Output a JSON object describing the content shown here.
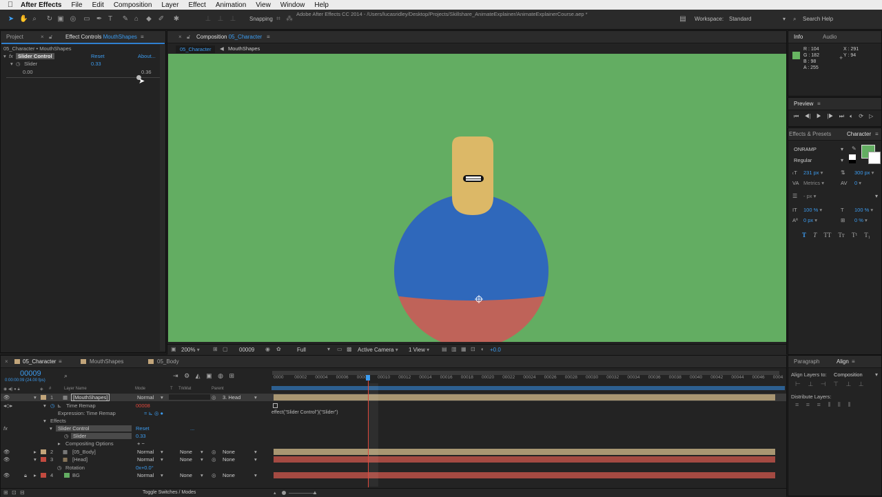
{
  "menubar": {
    "app_name": "After Effects",
    "items": [
      "File",
      "Edit",
      "Composition",
      "Layer",
      "Effect",
      "Animation",
      "View",
      "Window",
      "Help"
    ],
    "window_title": "Adobe After Effects CC 2014 - /Users/lucasridley/Desktop/Projects/Skillshare_AnimateExplainer/AnimateExplainerCourse.aep *"
  },
  "toolbar": {
    "snapping_label": "Snapping",
    "workspace_label": "Workspace:",
    "workspace_value": "Standard",
    "search_help": "Search Help"
  },
  "left_panel": {
    "tab_project": "Project",
    "tab_effect_controls": "Effect Controls",
    "tab_effect_controls_target": "MouthShapes",
    "breadcrumb": "05_Character • MouthShapes",
    "effect_name": "Slider Control",
    "reset_label": "Reset",
    "about_label": "About...",
    "slider_label": "Slider",
    "slider_value": "0.33",
    "slider_min": "0.00",
    "slider_max": "0.36",
    "fx_label": "fx"
  },
  "composition": {
    "tab_label": "Composition",
    "tab_comp_name": "05_Character",
    "sub_tab_active": "05_Character",
    "sub_tab_next": "MouthShapes",
    "zoom": "200%",
    "timecode": "00009",
    "resolution": "Full",
    "camera": "Active Camera",
    "views": "1 View",
    "exposure": "+0.0",
    "background_color": "#63ad62",
    "head_color": "#dcb867",
    "body_blue": "#2f68bb",
    "body_red": "#bf6359"
  },
  "info_panel": {
    "tab_info": "Info",
    "tab_audio": "Audio",
    "r": "R : 104",
    "g": "G : 182",
    "b": "B : 98",
    "a": "A : 255",
    "x": "X : 291",
    "y": "Y : 94",
    "swatch_color": "#68b662"
  },
  "preview_panel": {
    "title": "Preview"
  },
  "character_panel": {
    "tab_effects": "Effects & Presets",
    "tab_character": "Character",
    "font": "ONRAMP",
    "style": "Regular",
    "font_size": "231 px",
    "leading": "300 px",
    "kerning": "Metrics",
    "tracking": "0",
    "stroke": "- px",
    "vert_scale": "100 %",
    "horiz_scale": "100 %",
    "baseline": "0 px",
    "tsume": "0 %",
    "fill_color": "#63ad62"
  },
  "align_panel": {
    "tab_paragraph": "Paragraph",
    "tab_align": "Align",
    "align_to_label": "Align Layers to:",
    "align_to_value": "Composition",
    "distribute_label": "Distribute Layers:"
  },
  "timeline": {
    "tabs": [
      "05_Character",
      "MouthShapes",
      "05_Body"
    ],
    "timecode": "00009",
    "timecode_sub": "0:00:00:09 (24.00 fps)",
    "col_layer_name": "Layer Name",
    "col_mode": "Mode",
    "col_t": "T",
    "col_trkmat": "TrkMat",
    "col_parent": "Parent",
    "ruler_ticks": [
      "0000",
      "00002",
      "00004",
      "00006",
      "00008",
      "00010",
      "00012",
      "00014",
      "00016",
      "00018",
      "00020",
      "00022",
      "00024",
      "00026",
      "00028",
      "00030",
      "00032",
      "00034",
      "00036",
      "00038",
      "00040",
      "00042",
      "00044",
      "00046",
      "0004"
    ],
    "layers": [
      {
        "num": "1",
        "name": "[MouthShapes]",
        "mode": "Normal",
        "trkmat": "",
        "parent": "3. Head",
        "color": "#c2a57a",
        "bar": "#a89672"
      },
      {
        "num": "2",
        "name": "[05_Body]",
        "mode": "Normal",
        "trkmat": "None",
        "parent": "None",
        "color": "#c2a57a",
        "bar": "#a89672"
      },
      {
        "num": "3",
        "name": "[Head]",
        "mode": "Normal",
        "trkmat": "None",
        "parent": "None",
        "color": "#c24a3f",
        "bar": "#a44a42"
      },
      {
        "num": "4",
        "name": "BG",
        "mode": "Normal",
        "trkmat": "None",
        "parent": "None",
        "color": "#c24a3f",
        "bar": "#a44a42"
      }
    ],
    "time_remap_label": "Time Remap",
    "time_remap_value": "00008",
    "expression_label": "Expression: Time Remap",
    "expression_text": "effect(\"Slider Control\")(\"Slider\")",
    "effects_label": "Effects",
    "slider_control_label": "Slider Control",
    "reset_label": "Reset",
    "dots": "...",
    "slider_label": "Slider",
    "slider_value": "0.33",
    "compositing_label": "Compositing Options",
    "compositing_ops": "+ −",
    "rotation_label": "Rotation",
    "rotation_value": "0x+0.0°",
    "toggle_label": "Toggle Switches / Modes",
    "fx_label": "fx"
  }
}
